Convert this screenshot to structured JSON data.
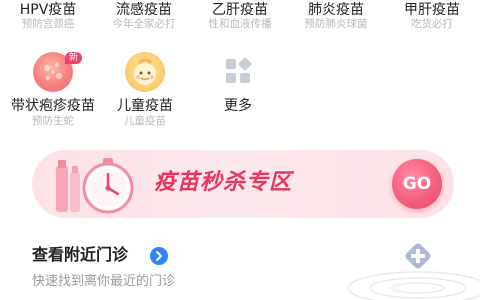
{
  "vaccines_row1": [
    {
      "label": "HPV疫苗",
      "sub": "预防宫颈癌"
    },
    {
      "label": "流感疫苗",
      "sub": "今年全家必打"
    },
    {
      "label": "乙肝疫苗",
      "sub": "性和血液传播"
    },
    {
      "label": "肺炎疫苗",
      "sub": "预防肺炎球菌"
    },
    {
      "label": "甲肝疫苗",
      "sub": "吃货必打"
    }
  ],
  "vaccines_row2": [
    {
      "label": "带状疱疹疫苗",
      "sub": "预防生蛇",
      "badge": "新",
      "icon": "virus-icon"
    },
    {
      "label": "儿童疫苗",
      "sub": "儿童疫苗",
      "icon": "baby-icon"
    },
    {
      "label": "更多",
      "sub": "",
      "icon": "grid-more-icon"
    }
  ],
  "banner": {
    "title": "疫苗秒杀专区",
    "go_label": "GO"
  },
  "nearby": {
    "title": "查看附近门诊",
    "subtitle": "快速找到离你最近的门诊"
  },
  "colors": {
    "accent": "#e8365f",
    "go": "#f45b7c",
    "link": "#2f86f0",
    "badge": "#f0426b"
  }
}
